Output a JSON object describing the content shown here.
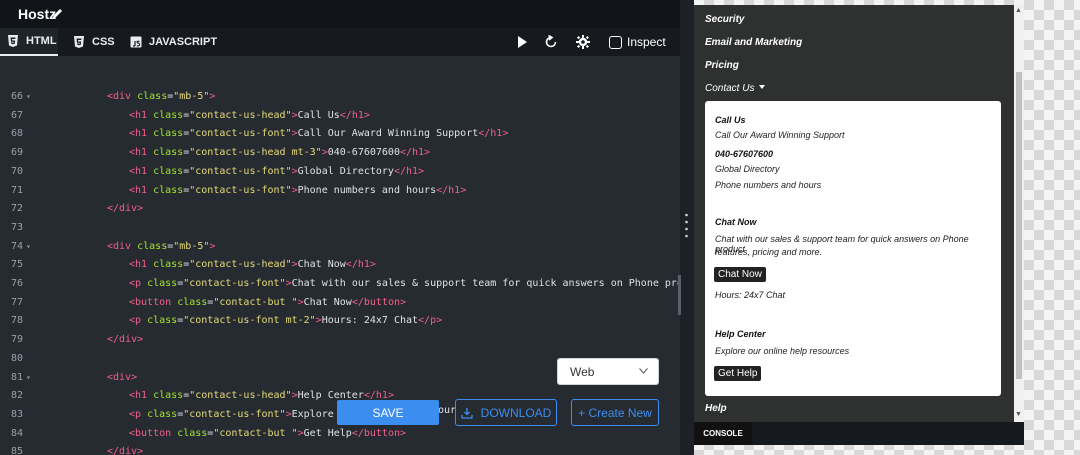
{
  "app": {
    "title": "Hostz"
  },
  "tabs": [
    {
      "label": "HTML"
    },
    {
      "label": "CSS"
    },
    {
      "label": "JAVASCRIPT"
    }
  ],
  "toolbar": {
    "inspect_label": "Inspect"
  },
  "editor": {
    "lines": [
      {
        "num": "66",
        "fold": true,
        "indent": 0,
        "tokens": [
          [
            "t",
            "<div"
          ],
          [
            "p",
            " "
          ],
          [
            "a",
            "class"
          ],
          [
            "p",
            "="
          ],
          [
            "s",
            "\"mb-5\""
          ],
          [
            "t",
            ">"
          ]
        ]
      },
      {
        "num": "67",
        "fold": false,
        "indent": 1,
        "tokens": [
          [
            "t",
            "<h1"
          ],
          [
            "p",
            " "
          ],
          [
            "a",
            "class"
          ],
          [
            "p",
            "="
          ],
          [
            "s",
            "\"contact-us-head\""
          ],
          [
            "t",
            ">"
          ],
          [
            "p",
            "Call Us"
          ],
          [
            "t",
            "</h1>"
          ]
        ]
      },
      {
        "num": "68",
        "fold": false,
        "indent": 1,
        "tokens": [
          [
            "t",
            "<h1"
          ],
          [
            "p",
            " "
          ],
          [
            "a",
            "class"
          ],
          [
            "p",
            "="
          ],
          [
            "s",
            "\"contact-us-font\""
          ],
          [
            "t",
            ">"
          ],
          [
            "p",
            "Call Our Award Winning Support"
          ],
          [
            "t",
            "</h1>"
          ]
        ]
      },
      {
        "num": "69",
        "fold": false,
        "indent": 1,
        "tokens": [
          [
            "t",
            "<h1"
          ],
          [
            "p",
            " "
          ],
          [
            "a",
            "class"
          ],
          [
            "p",
            "="
          ],
          [
            "s",
            "\"contact-us-head mt-3\""
          ],
          [
            "t",
            ">"
          ],
          [
            "p",
            "040-67607600"
          ],
          [
            "t",
            "</h1>"
          ]
        ]
      },
      {
        "num": "70",
        "fold": false,
        "indent": 1,
        "tokens": [
          [
            "t",
            "<h1"
          ],
          [
            "p",
            " "
          ],
          [
            "a",
            "class"
          ],
          [
            "p",
            "="
          ],
          [
            "s",
            "\"contact-us-font\""
          ],
          [
            "t",
            ">"
          ],
          [
            "p",
            "Global Directory"
          ],
          [
            "t",
            "</h1>"
          ]
        ]
      },
      {
        "num": "71",
        "fold": false,
        "indent": 1,
        "tokens": [
          [
            "t",
            "<h1"
          ],
          [
            "p",
            " "
          ],
          [
            "a",
            "class"
          ],
          [
            "p",
            "="
          ],
          [
            "s",
            "\"contact-us-font\""
          ],
          [
            "t",
            ">"
          ],
          [
            "p",
            "Phone numbers and hours"
          ],
          [
            "t",
            "</h1>"
          ]
        ]
      },
      {
        "num": "72",
        "fold": false,
        "indent": 0,
        "tokens": [
          [
            "t",
            "</div>"
          ]
        ]
      },
      {
        "num": "73",
        "fold": false,
        "indent": 0,
        "tokens": []
      },
      {
        "num": "74",
        "fold": true,
        "indent": 0,
        "tokens": [
          [
            "t",
            "<div"
          ],
          [
            "p",
            " "
          ],
          [
            "a",
            "class"
          ],
          [
            "p",
            "="
          ],
          [
            "s",
            "\"mb-5\""
          ],
          [
            "t",
            ">"
          ]
        ]
      },
      {
        "num": "75",
        "fold": false,
        "indent": 1,
        "tokens": [
          [
            "t",
            "<h1"
          ],
          [
            "p",
            " "
          ],
          [
            "a",
            "class"
          ],
          [
            "p",
            "="
          ],
          [
            "s",
            "\"contact-us-head\""
          ],
          [
            "t",
            ">"
          ],
          [
            "p",
            "Chat Now"
          ],
          [
            "t",
            "</h1>"
          ]
        ]
      },
      {
        "num": "76",
        "fold": false,
        "indent": 1,
        "tokens": [
          [
            "t",
            "<p"
          ],
          [
            "p",
            " "
          ],
          [
            "a",
            "class"
          ],
          [
            "p",
            "="
          ],
          [
            "s",
            "\"contact-us-font\""
          ],
          [
            "t",
            ">"
          ],
          [
            "p",
            "Chat with our sales & support team for quick answers on Phone produ"
          ]
        ]
      },
      {
        "num": "77",
        "fold": false,
        "indent": 1,
        "tokens": [
          [
            "t",
            "<button"
          ],
          [
            "p",
            " "
          ],
          [
            "a",
            "class"
          ],
          [
            "p",
            "="
          ],
          [
            "s",
            "\"contact-but \""
          ],
          [
            "t",
            ">"
          ],
          [
            "p",
            "Chat Now"
          ],
          [
            "t",
            "</button>"
          ]
        ]
      },
      {
        "num": "78",
        "fold": false,
        "indent": 1,
        "tokens": [
          [
            "t",
            "<p"
          ],
          [
            "p",
            " "
          ],
          [
            "a",
            "class"
          ],
          [
            "p",
            "="
          ],
          [
            "s",
            "\"contact-us-font mt-2\""
          ],
          [
            "t",
            ">"
          ],
          [
            "p",
            "Hours: 24x7 Chat"
          ],
          [
            "t",
            "</p>"
          ]
        ]
      },
      {
        "num": "79",
        "fold": false,
        "indent": 0,
        "tokens": [
          [
            "t",
            "</div>"
          ]
        ]
      },
      {
        "num": "80",
        "fold": false,
        "indent": 0,
        "tokens": []
      },
      {
        "num": "81",
        "fold": true,
        "indent": 0,
        "tokens": [
          [
            "t",
            "<div>"
          ]
        ]
      },
      {
        "num": "82",
        "fold": false,
        "indent": 1,
        "tokens": [
          [
            "t",
            "<h1"
          ],
          [
            "p",
            " "
          ],
          [
            "a",
            "class"
          ],
          [
            "p",
            "="
          ],
          [
            "s",
            "\"contact-us-head\""
          ],
          [
            "t",
            ">"
          ],
          [
            "p",
            "Help Center"
          ],
          [
            "t",
            "</h1>"
          ]
        ]
      },
      {
        "num": "83",
        "fold": false,
        "indent": 1,
        "tokens": [
          [
            "t",
            "<p"
          ],
          [
            "p",
            " "
          ],
          [
            "a",
            "class"
          ],
          [
            "p",
            "="
          ],
          [
            "s",
            "\"contact-us-font\""
          ],
          [
            "t",
            ">"
          ],
          [
            "p",
            "Explore o"
          ]
        ]
      },
      {
        "num": "84",
        "fold": false,
        "indent": 1,
        "tokens": [
          [
            "t",
            "<button"
          ],
          [
            "p",
            " "
          ],
          [
            "a",
            "class"
          ],
          [
            "p",
            "="
          ],
          [
            "s",
            "\"contact-but \""
          ],
          [
            "t",
            ">"
          ],
          [
            "p",
            "Get Help"
          ],
          [
            "t",
            "</button>"
          ]
        ]
      },
      {
        "num": "85",
        "fold": false,
        "indent": 0,
        "tokens": [
          [
            "t",
            "</div>"
          ]
        ]
      }
    ]
  },
  "controls": {
    "view_select": "Web",
    "save_label": "SAVE",
    "download_label": "DOWNLOAD",
    "create_label": "+ Create New",
    "stray_text": "our"
  },
  "preview": {
    "nav": {
      "security": "Security",
      "email": "Email and Marketing",
      "pricing": "Pricing",
      "contact": "Contact Us",
      "help": "Help"
    },
    "dropdown": {
      "call_head": "Call Us",
      "call_sub": "Call Our Award Winning Support",
      "phone": "040-67607600",
      "directory": "Global Directory",
      "hours_text": "Phone numbers and hours",
      "chat_head": "Chat Now",
      "chat_desc_1": "Chat with our sales & support team for quick answers on Phone product",
      "chat_desc_2": "features, pricing and more.",
      "chat_button": "Chat Now",
      "chat_hours": "Hours: 24x7 Chat",
      "help_head": "Help Center",
      "help_desc": "Explore our online help resources",
      "help_button": "Get Help"
    },
    "console_label": "CONSOLE"
  },
  "colors": {
    "accent": "#3b8ef0",
    "tag": "#f25f8a",
    "attr": "#a6e22e",
    "string": "#e6db74"
  }
}
